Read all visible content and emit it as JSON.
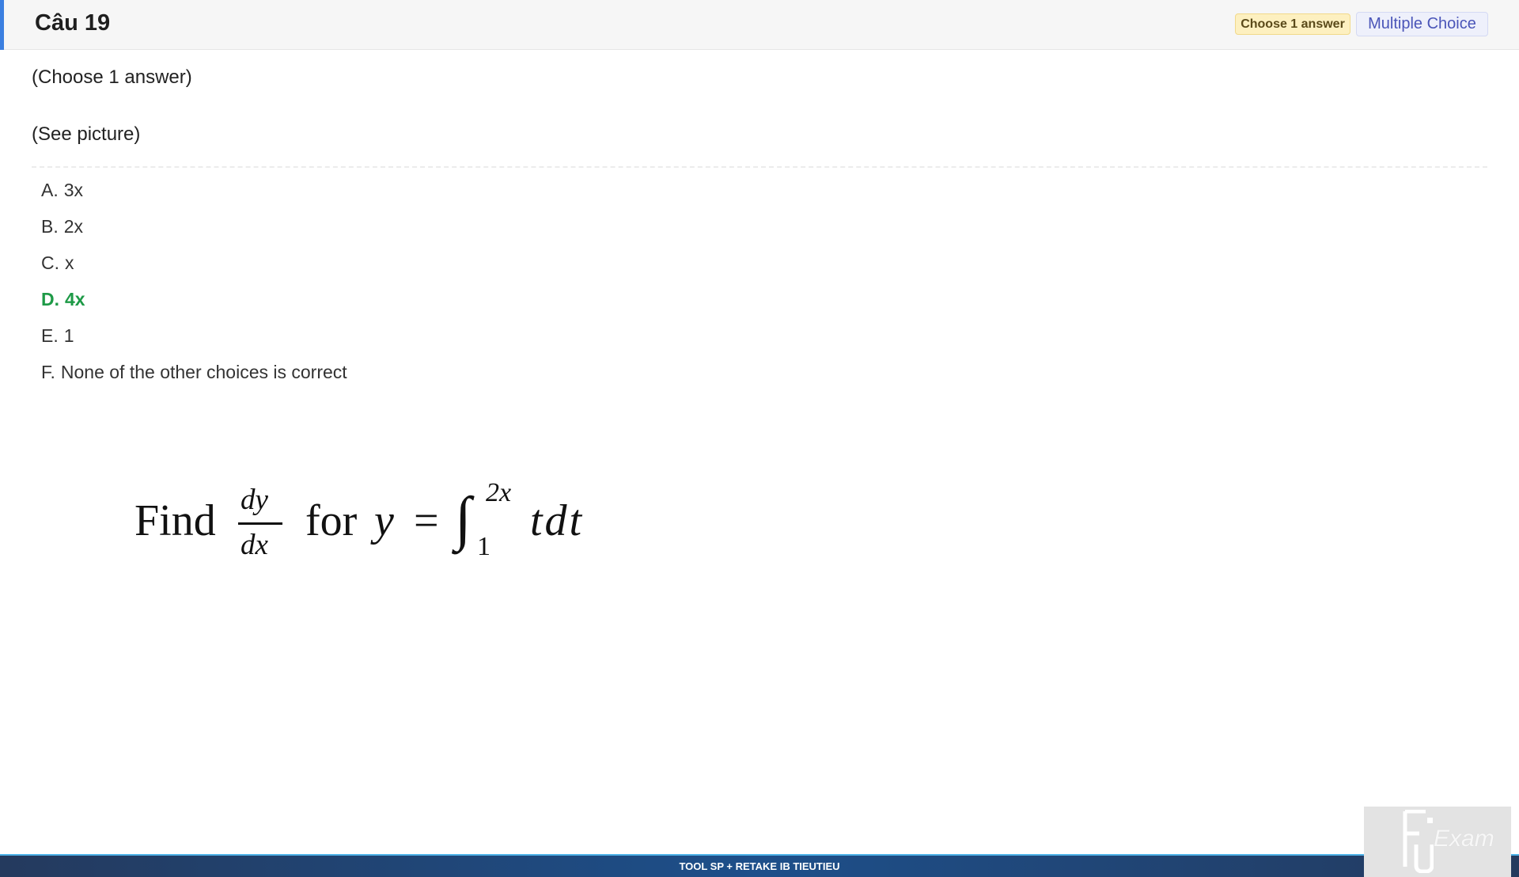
{
  "header": {
    "title": "Câu 19",
    "badge_answer": "Choose 1 answer",
    "badge_type": "Multiple Choice",
    "accent_color": "#3b7fe0"
  },
  "question": {
    "instruction": "(Choose 1 answer)",
    "body": "(See picture)"
  },
  "answers": [
    {
      "letter": "A.",
      "text": "3x",
      "correct": false
    },
    {
      "letter": "B.",
      "text": "2x",
      "correct": false
    },
    {
      "letter": "C.",
      "text": "x",
      "correct": false
    },
    {
      "letter": "D.",
      "text": "4x",
      "correct": true
    },
    {
      "letter": "E.",
      "text": "1",
      "correct": false
    },
    {
      "letter": "F.",
      "text": "None of the other choices is correct",
      "correct": false
    }
  ],
  "correct_color": "#1e9a47",
  "formula": {
    "find": "Find",
    "numerator": "dy",
    "denominator": "dx",
    "for": "for",
    "lhs": "y",
    "equals": "=",
    "integral_sign": "∫",
    "upper_limit": "2x",
    "lower_limit": "1",
    "integrand": "tdt"
  },
  "footer": {
    "text": "TOOL SP + RETAKE IB TIEUTIEU"
  },
  "logo": {
    "text": "Exam",
    "icon": "fu-exam-logo-icon"
  }
}
